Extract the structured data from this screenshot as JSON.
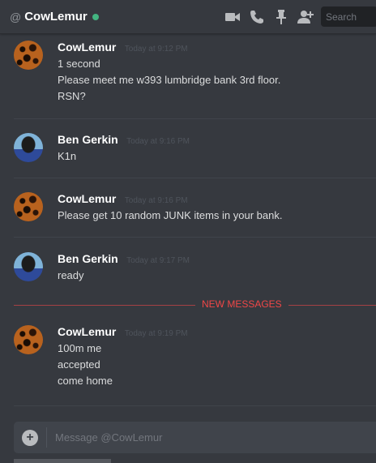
{
  "header": {
    "at_symbol": "@",
    "username": "CowLemur",
    "status_color": "#43b581",
    "icons": [
      "video-call-icon",
      "voice-call-icon",
      "pin-icon",
      "add-friend-icon"
    ],
    "search_placeholder": "Search"
  },
  "messages": [
    {
      "author": "CowLemur",
      "timestamp": "Today at 9:12 PM",
      "avatar": "cow-pattern-avatar",
      "lines": [
        "1 second",
        "Please meet me w393 lumbridge bank 3rd floor.",
        "RSN?"
      ]
    },
    {
      "author": "Ben Gerkin",
      "timestamp": "Today at 9:16 PM",
      "avatar": "person-avatar",
      "lines": [
        "K1n"
      ]
    },
    {
      "author": "CowLemur",
      "timestamp": "Today at 9:16 PM",
      "avatar": "cow-pattern-avatar",
      "lines": [
        "Please get 10 random JUNK items in your bank."
      ]
    },
    {
      "author": "Ben Gerkin",
      "timestamp": "Today at 9:17 PM",
      "avatar": "person-avatar",
      "lines": [
        "ready"
      ]
    },
    {
      "author": "CowLemur",
      "timestamp": "Today at 9:19 PM",
      "avatar": "cow-pattern-avatar",
      "lines": [
        "100m me",
        "accepted",
        "come home"
      ]
    }
  ],
  "new_messages_label": "NEW MESSAGES",
  "new_messages_color": "#f04747",
  "composer": {
    "placeholder": "Message @CowLemur",
    "upload_symbol": "+"
  }
}
